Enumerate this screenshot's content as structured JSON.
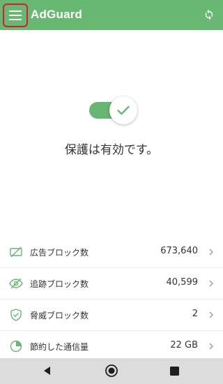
{
  "app": {
    "title": "AdGuard",
    "accent_color": "#68b874"
  },
  "topbar": {
    "menu_icon": "hamburger-menu-icon",
    "refresh_icon": "refresh-icon"
  },
  "protection": {
    "enabled": true,
    "status_text": "保護は有効です。"
  },
  "stats": [
    {
      "icon": "ad-block-icon",
      "label": "広告ブロック数",
      "value": "673,640"
    },
    {
      "icon": "tracking-block-icon",
      "label": "追跡ブロック数",
      "value": "40,599"
    },
    {
      "icon": "threat-shield-icon",
      "label": "脅威ブロック数",
      "value": "2"
    },
    {
      "icon": "data-saved-pie-icon",
      "label": "節約した通信量",
      "value": "22 GB"
    }
  ],
  "navbar": {
    "back_icon": "back-icon",
    "home_icon": "home-icon",
    "recent_icon": "recent-apps-icon"
  }
}
